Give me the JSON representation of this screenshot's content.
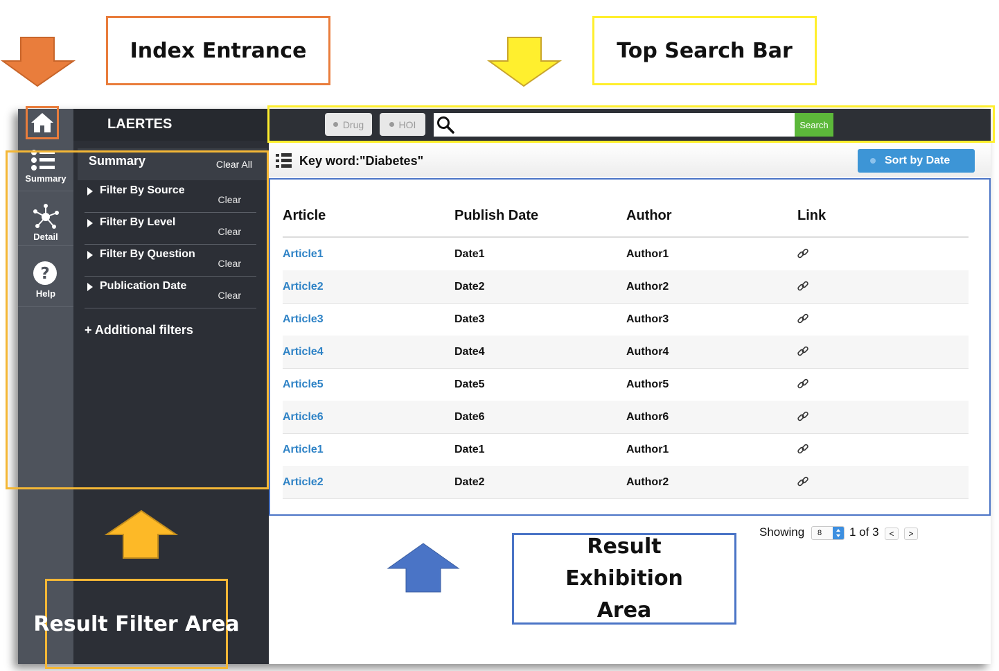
{
  "annotations": {
    "index_entrance": "Index Entrance",
    "top_search_bar": "Top Search Bar",
    "result_filter_area": "Result Filter Area",
    "result_exhibition_area": "Result Exhibition Area"
  },
  "app": {
    "title": "LAERTES"
  },
  "rail": [
    {
      "label": "Summary",
      "icon": "list-icon"
    },
    {
      "label": "Detail",
      "icon": "network-icon"
    },
    {
      "label": "Help",
      "icon": "help-icon"
    }
  ],
  "sidebar": {
    "summary_label": "Summary",
    "clear_all_label": "Clear All",
    "filters": [
      {
        "label": "Filter By Source",
        "clear": "Clear"
      },
      {
        "label": "Filter By Level",
        "clear": "Clear"
      },
      {
        "label": "Filter By Question",
        "clear": "Clear"
      },
      {
        "label": "Publication Date",
        "clear": "Clear"
      }
    ],
    "additional_filters_label": "+ Additional filters"
  },
  "search": {
    "toggle_drug": "Drug",
    "toggle_hoi": "HOI",
    "input_value": "",
    "button_label": "Search"
  },
  "results_header": {
    "keyword": "Key word:\"Diabetes\"",
    "sort_label": "Sort by Date"
  },
  "table": {
    "columns": [
      "Article",
      "Publish Date",
      "Author",
      "Link"
    ],
    "rows": [
      {
        "article": "Article1",
        "date": "Date1",
        "author": "Author1"
      },
      {
        "article": "Article2",
        "date": "Date2",
        "author": "Author2"
      },
      {
        "article": "Article3",
        "date": "Date3",
        "author": "Author3"
      },
      {
        "article": "Article4",
        "date": "Date4",
        "author": "Author4"
      },
      {
        "article": "Article5",
        "date": "Date5",
        "author": "Author5"
      },
      {
        "article": "Article6",
        "date": "Date6",
        "author": "Author6"
      },
      {
        "article": "Article1",
        "date": "Date1",
        "author": "Author1"
      },
      {
        "article": "Article2",
        "date": "Date2",
        "author": "Author2"
      }
    ]
  },
  "pagination": {
    "showing_label": "Showing",
    "page_size": "8",
    "page_info": "1 of 3",
    "prev": "<",
    "next": ">"
  },
  "colors": {
    "accent_blue": "#3d95d6",
    "search_green": "#5cb83a",
    "link_blue": "#2f83c6",
    "sidebar_dark": "#2c2f36",
    "rail_gray": "#4e535c"
  }
}
